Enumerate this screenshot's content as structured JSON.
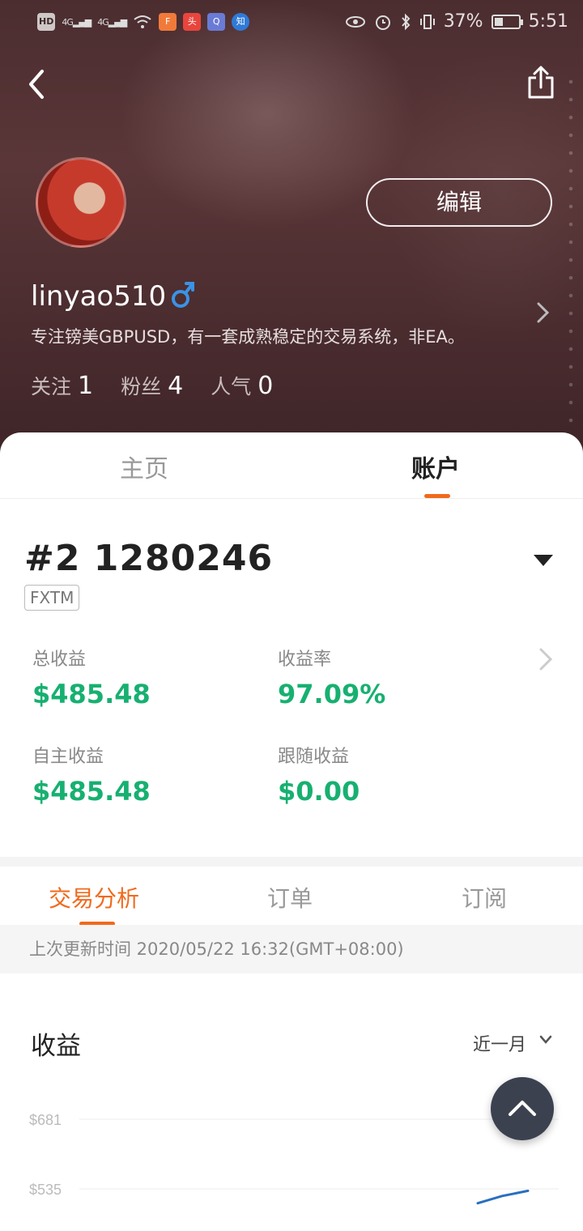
{
  "status_bar": {
    "hd": "HD",
    "signal1": "4G",
    "signal2": "4G",
    "battery_text": "37%",
    "battery_level": 0.37,
    "time": "5:51"
  },
  "profile": {
    "edit_label": "编辑",
    "username": "linyao510",
    "gender": "♂",
    "bio": "专注镑美GBPUSD，有一套成熟稳定的交易系统，非EA。",
    "stats": [
      {
        "label": "关注",
        "value": "1"
      },
      {
        "label": "粉丝",
        "value": "4"
      },
      {
        "label": "人气",
        "value": "0"
      }
    ]
  },
  "main_tabs": {
    "home": "主页",
    "account": "账户"
  },
  "account": {
    "number": "#2 1280246",
    "broker": "FXTM",
    "metrics": [
      {
        "label": "总收益",
        "value": "$485.48"
      },
      {
        "label": "收益率",
        "value": "97.09%"
      },
      {
        "label": "自主收益",
        "value": "$485.48"
      },
      {
        "label": "跟随收益",
        "value": "$0.00"
      }
    ]
  },
  "sub_tabs": {
    "analysis": "交易分析",
    "orders": "订单",
    "subscriptions": "订阅"
  },
  "update_text": "上次更新时间 2020/05/22 16:32(GMT+08:00)",
  "earnings": {
    "title": "收益",
    "period": "近一月"
  },
  "colors": {
    "accent": "#f06a1c",
    "positive": "#17b070",
    "line": "#2a6fc0"
  },
  "chart_data": {
    "type": "line",
    "y_ticks": [
      "$681",
      "$535"
    ],
    "series": [
      {
        "values": [
          505,
          520,
          531
        ]
      }
    ]
  }
}
